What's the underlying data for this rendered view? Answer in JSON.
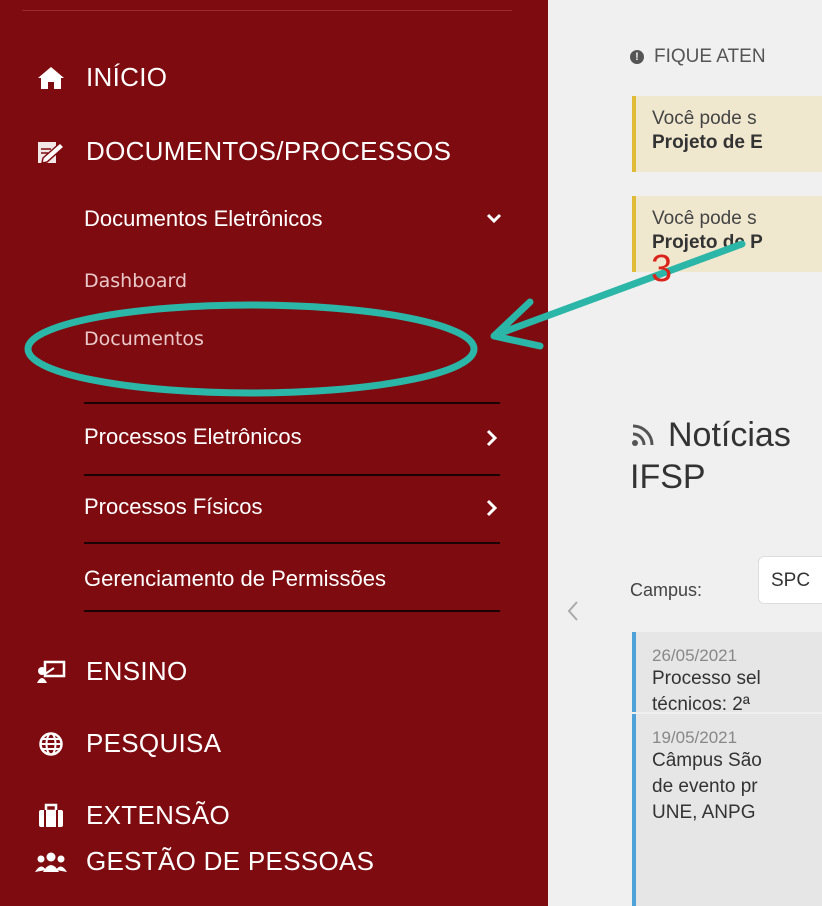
{
  "sidebar": {
    "menu": [
      {
        "label": "INÍCIO",
        "icon": "home-icon"
      },
      {
        "label": "DOCUMENTOS/PROCESSOS",
        "icon": "documents-edit-icon"
      },
      {
        "label": "ENSINO",
        "icon": "teacher-board-icon"
      },
      {
        "label": "PESQUISA",
        "icon": "globe-icon"
      },
      {
        "label": "EXTENSÃO",
        "icon": "briefcase-icon"
      },
      {
        "label": "GESTÃO DE PESSOAS",
        "icon": "users-icon"
      }
    ],
    "submenu": {
      "documentos_eletronicos": "Documentos Eletrônicos",
      "dashboard": "Dashboard",
      "documentos": "Documentos",
      "processos_eletronicos": "Processos Eletrônicos",
      "processos_fisicos": "Processos Físicos",
      "gerenciamento": "Gerenciamento de Permissões"
    },
    "colors": {
      "background": "#7e0b0f",
      "separator": "#1b0203"
    }
  },
  "main": {
    "attention": "FIQUE ATEN",
    "alerts": [
      {
        "line1": "Você pode s",
        "line2": "Projeto de E"
      },
      {
        "line1": "Você pode s",
        "line2": "Projeto de P"
      }
    ],
    "news": {
      "title_line1": "Notícias",
      "title_line2": "IFSP",
      "rss_icon": "rss-icon",
      "campus_label": "Campus:",
      "campus_value": "SPC",
      "items": [
        {
          "date": "26/05/2021",
          "lines": [
            "Processo sel",
            "técnicos: 2ª"
          ]
        },
        {
          "date": "19/05/2021",
          "lines": [
            "Câmpus São",
            "de evento pr",
            "UNE, ANPG"
          ]
        }
      ]
    }
  },
  "annotation": {
    "number": "3",
    "ellipse_color": "#2bb6a8",
    "number_color": "#d9241c"
  }
}
